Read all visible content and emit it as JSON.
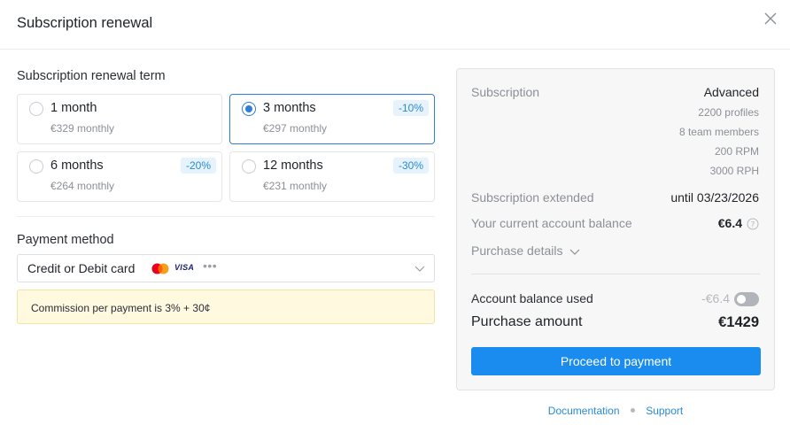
{
  "dialog": {
    "title": "Subscription renewal"
  },
  "term_section": {
    "label": "Subscription renewal term",
    "options": [
      {
        "name": "1 month",
        "price": "€329 monthly",
        "discount": null,
        "selected": false
      },
      {
        "name": "3 months",
        "price": "€297 monthly",
        "discount": "-10%",
        "selected": true
      },
      {
        "name": "6 months",
        "price": "€264 monthly",
        "discount": "-20%",
        "selected": false
      },
      {
        "name": "12 months",
        "price": "€231 monthly",
        "discount": "-30%",
        "selected": false
      }
    ]
  },
  "payment": {
    "label": "Payment method",
    "selected_method": "Credit or Debit card",
    "card_icons": [
      "mastercard-icon",
      "visa-icon",
      "more-icon"
    ],
    "visa_text": "VISA",
    "commission_note": "Commission per payment is 3% + 30¢"
  },
  "summary": {
    "subscription_label": "Subscription",
    "plan": "Advanced",
    "plan_details": [
      "2200 profiles",
      "8 team members",
      "200 RPM",
      "3000 RPH"
    ],
    "extended_label": "Subscription extended",
    "extended_value": "until 03/23/2026",
    "balance_label": "Your current account balance",
    "balance_value": "€6.4",
    "details_toggle": "Purchase details",
    "balance_used_label": "Account balance used",
    "balance_used_value": "-€6.4",
    "balance_used_enabled": false,
    "purchase_label": "Purchase amount",
    "purchase_value": "€1429",
    "proceed_label": "Proceed to payment"
  },
  "footer": {
    "documentation": "Documentation",
    "support": "Support"
  },
  "colors": {
    "accent": "#1a8cf0",
    "selected_border": "#2f7fd9",
    "discount_bg": "#e6f3fc",
    "notice_bg": "#fff9e0"
  }
}
